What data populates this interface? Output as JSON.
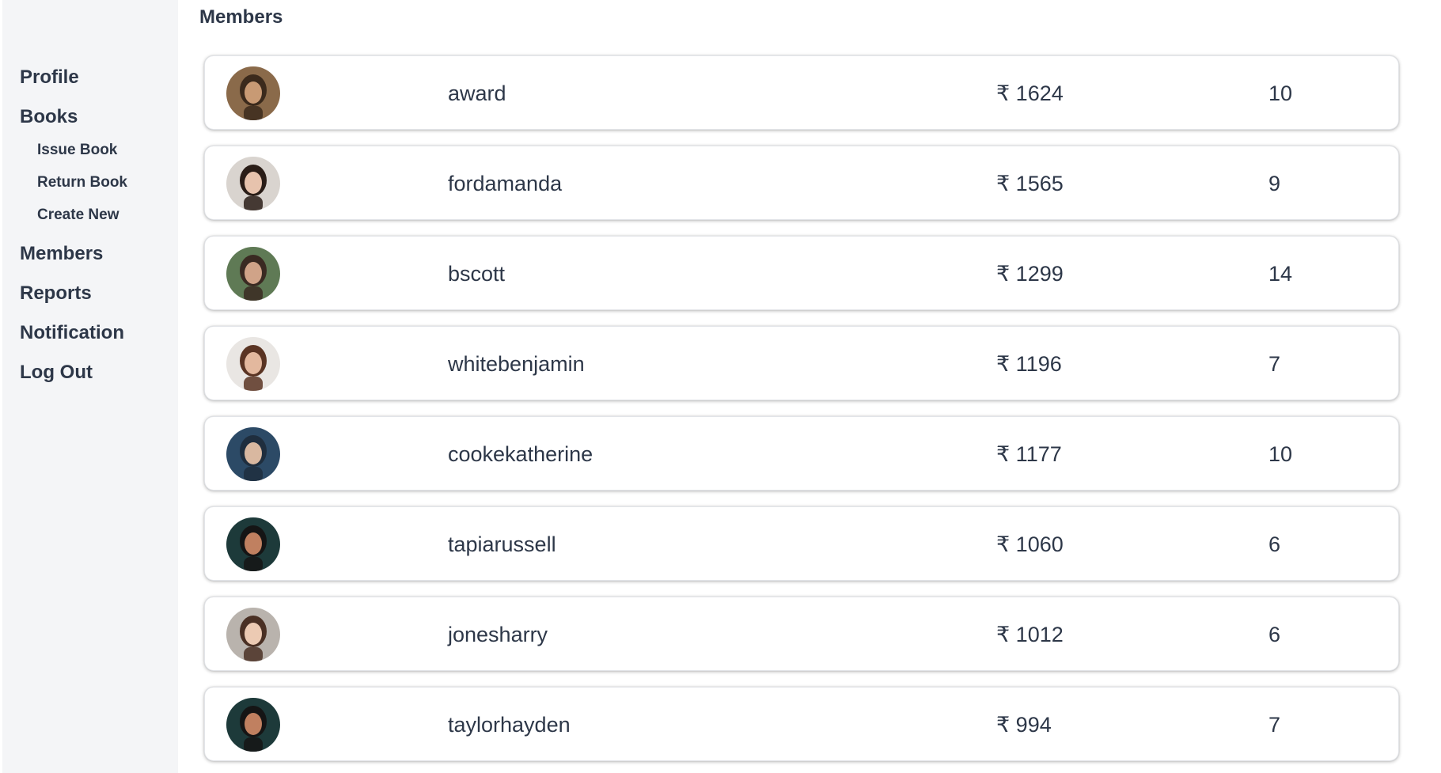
{
  "sidebar": {
    "items": [
      {
        "label": "Profile"
      },
      {
        "label": "Books",
        "children": [
          {
            "label": "Issue Book"
          },
          {
            "label": "Return Book"
          },
          {
            "label": "Create New"
          }
        ]
      },
      {
        "label": "Members"
      },
      {
        "label": "Reports"
      },
      {
        "label": "Notification"
      },
      {
        "label": "Log Out"
      }
    ]
  },
  "main": {
    "title": "Members",
    "members": [
      {
        "name": "award",
        "fine": "₹ 1624",
        "count": "10",
        "avatar": "avatar-man-beard",
        "bg": "#8a6a4a",
        "skin": "#c89a74",
        "hair": "#3b2a1c"
      },
      {
        "name": "fordamanda",
        "fine": "₹ 1565",
        "count": "9",
        "avatar": "avatar-woman-dark-hair",
        "bg": "#d9d4cf",
        "skin": "#e7c3ad",
        "hair": "#2a1d17"
      },
      {
        "name": "bscott",
        "fine": "₹ 1299",
        "count": "14",
        "avatar": "avatar-woman-curly-hair",
        "bg": "#5f7a55",
        "skin": "#d0a388",
        "hair": "#3a2a22"
      },
      {
        "name": "whitebenjamin",
        "fine": "₹ 1196",
        "count": "7",
        "avatar": "avatar-woman-brown-hair",
        "bg": "#e9e6e3",
        "skin": "#e3b89e",
        "hair": "#5a3423"
      },
      {
        "name": "cookekatherine",
        "fine": "₹ 1177",
        "count": "10",
        "avatar": "avatar-man-shaved",
        "bg": "#2c4a66",
        "skin": "#d9b8a0",
        "hair": "#1f2e3e"
      },
      {
        "name": "tapiarussell",
        "fine": "₹ 1060",
        "count": "6",
        "avatar": "avatar-man-sunglasses",
        "bg": "#1d3a3a",
        "skin": "#c08060",
        "hair": "#151515"
      },
      {
        "name": "jonesharry",
        "fine": "₹ 1012",
        "count": "6",
        "avatar": "avatar-woman-smiling",
        "bg": "#b9b3ad",
        "skin": "#eccab3",
        "hair": "#4a3024"
      },
      {
        "name": "taylorhayden",
        "fine": "₹ 994",
        "count": "7",
        "avatar": "avatar-man-sunglasses",
        "bg": "#1d3a3a",
        "skin": "#c08060",
        "hair": "#151515"
      }
    ]
  }
}
